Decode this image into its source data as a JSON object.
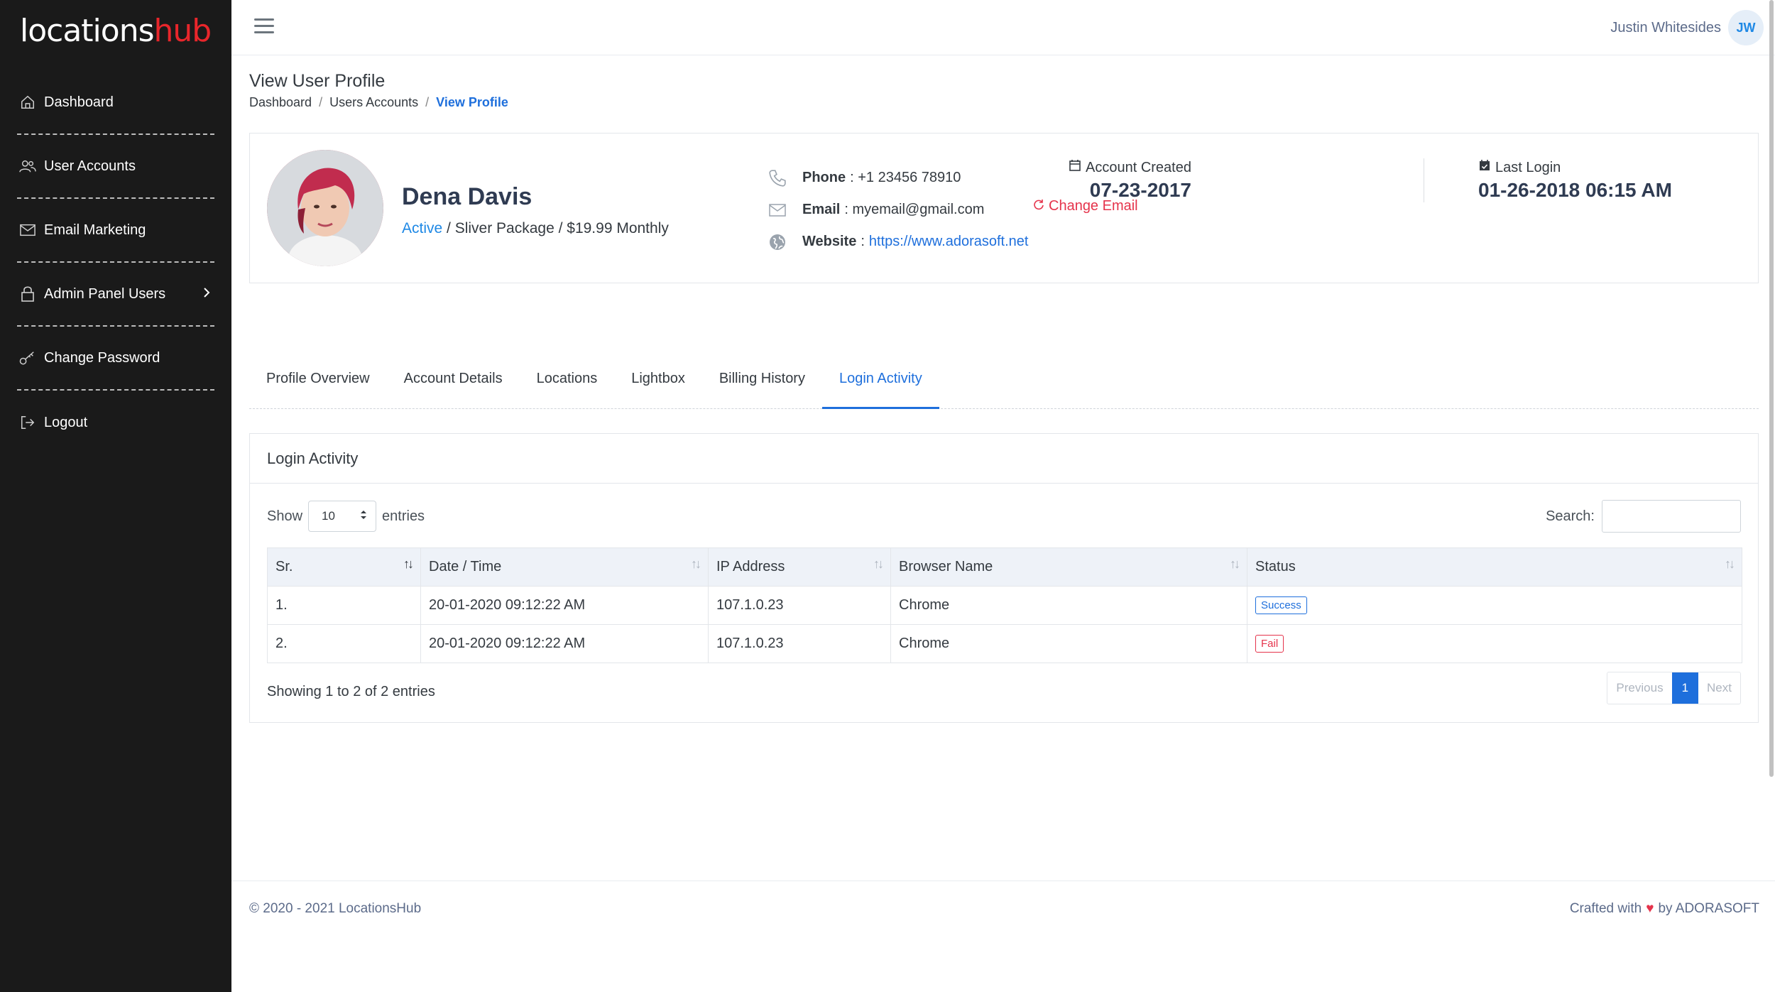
{
  "brand": {
    "part1": "locations",
    "part2": "hub"
  },
  "sidebar": {
    "items": [
      {
        "label": "Dashboard",
        "icon": "home-icon"
      },
      {
        "label": "User Accounts",
        "icon": "users-icon"
      },
      {
        "label": "Email Marketing",
        "icon": "mail-icon"
      },
      {
        "label": "Admin Panel Users",
        "icon": "lock-icon"
      },
      {
        "label": "Change Password",
        "icon": "key-icon"
      },
      {
        "label": "Logout",
        "icon": "logout-icon"
      }
    ]
  },
  "header": {
    "user_name": "Justin Whitesides",
    "user_initials": "JW"
  },
  "page": {
    "title": "View User Profile",
    "breadcrumb": [
      "Dashboard",
      "Users Accounts",
      "View Profile"
    ]
  },
  "profile": {
    "name": "Dena Davis",
    "status": "Active",
    "plan": " / Sliver Package / $19.99 Monthly",
    "phone_label": "Phone",
    "phone": ": +1 23456 78910",
    "email_label": "Email",
    "email": ": myemail@gmail.com",
    "website_label": "Website",
    "website_sep": ":",
    "website": "https://www.adorasoft.net",
    "change_email": "Change Email",
    "account_created_label": "Account Created",
    "account_created": "07-23-2017",
    "last_login_label": "Last Login",
    "last_login": "01-26-2018 06:15 AM"
  },
  "tabs": [
    "Profile Overview",
    "Account Details",
    "Locations",
    "Lightbox",
    "Billing History",
    "Login Activity"
  ],
  "activity": {
    "title": "Login Activity",
    "show_label": "Show",
    "page_size": "10",
    "entries_label": "entries",
    "search_label": "Search:",
    "search_value": "",
    "columns": [
      "Sr.",
      "Date / Time",
      "IP Address",
      "Browser Name",
      "Status"
    ],
    "rows": [
      {
        "sr": "1.",
        "datetime": "20-01-2020 09:12:22 AM",
        "ip": "107.1.0.23",
        "browser": "Chrome",
        "status": "Success"
      },
      {
        "sr": "2.",
        "datetime": "20-01-2020 09:12:22 AM",
        "ip": "107.1.0.23",
        "browser": "Chrome",
        "status": "Fail"
      }
    ],
    "info": "Showing 1 to 2 of 2 entries",
    "prev": "Previous",
    "current_page": "1",
    "next": "Next"
  },
  "footer": {
    "copyright": "© 2020 - 2021 LocationsHub",
    "crafted_with": "Crafted with",
    "by": "by ADORASOFT"
  },
  "colors": {
    "sidebar_bg": "#1a1a1a",
    "accent": "#1e6fdc",
    "danger": "#e5334b",
    "brand_red": "#e8262b"
  }
}
